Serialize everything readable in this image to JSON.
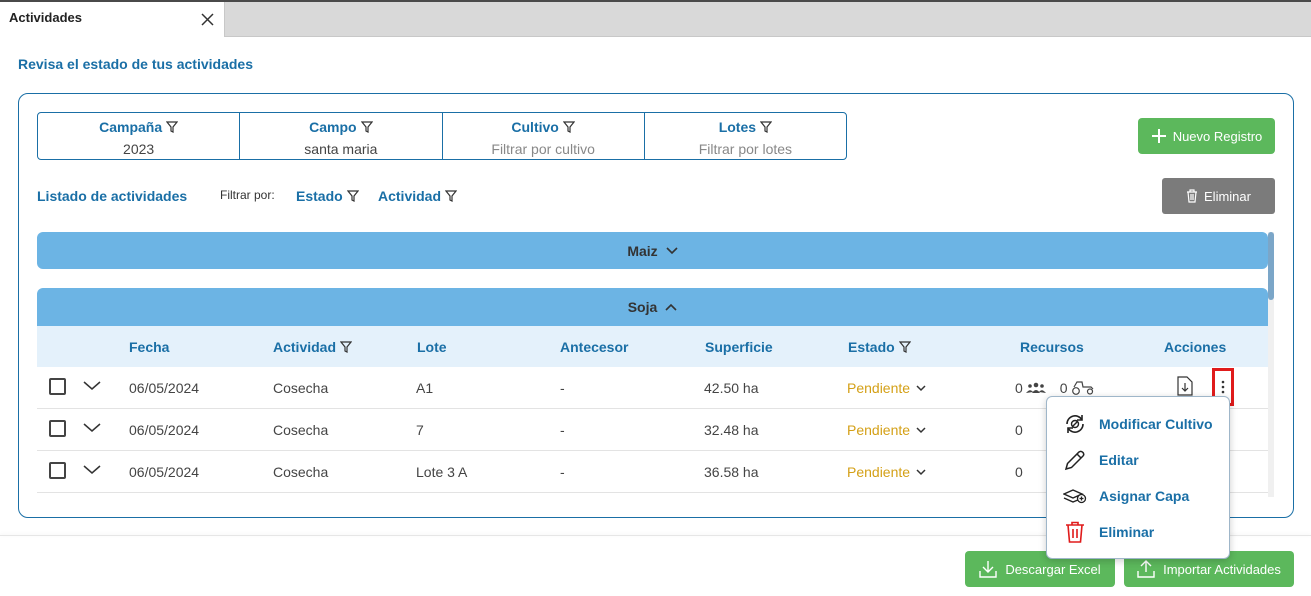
{
  "tab": {
    "title": "Actividades"
  },
  "page": {
    "subtitle": "Revisa el estado de tus actividades"
  },
  "filters": [
    {
      "label": "Campaña",
      "value": "2023",
      "is_placeholder": false
    },
    {
      "label": "Campo",
      "value": "santa maria",
      "is_placeholder": false
    },
    {
      "label": "Cultivo",
      "value": "Filtrar por cultivo",
      "is_placeholder": true
    },
    {
      "label": "Lotes",
      "value": "Filtrar por lotes",
      "is_placeholder": true
    }
  ],
  "buttons": {
    "new_record": "Nuevo Registro",
    "delete": "Eliminar",
    "download_excel": "Descargar Excel",
    "import": "Importar Actividades"
  },
  "list": {
    "title": "Listado de actividades",
    "filter_by": "Filtrar por:",
    "filter_estado": "Estado",
    "filter_actividad": "Actividad"
  },
  "groups": [
    {
      "name": "Maiz",
      "expanded": false
    },
    {
      "name": "Soja",
      "expanded": true
    }
  ],
  "table": {
    "headers": {
      "fecha": "Fecha",
      "actividad": "Actividad",
      "lote": "Lote",
      "antecesor": "Antecesor",
      "superficie": "Superficie",
      "estado": "Estado",
      "recursos": "Recursos",
      "acciones": "Acciones"
    },
    "rows": [
      {
        "fecha": "06/05/2024",
        "actividad": "Cosecha",
        "lote": "A1",
        "antecesor": "-",
        "superficie": "42.50 ha",
        "estado": "Pendiente",
        "personas": "0",
        "maquinas": "0"
      },
      {
        "fecha": "06/05/2024",
        "actividad": "Cosecha",
        "lote": "7",
        "antecesor": "-",
        "superficie": "32.48 ha",
        "estado": "Pendiente",
        "personas": "0",
        "maquinas": ""
      },
      {
        "fecha": "06/05/2024",
        "actividad": "Cosecha",
        "lote": "Lote 3 A",
        "antecesor": "-",
        "superficie": "36.58 ha",
        "estado": "Pendiente",
        "personas": "0",
        "maquinas": ""
      }
    ]
  },
  "context_menu": {
    "items": [
      {
        "label": "Modificar Cultivo",
        "icon": "modify-crop-icon"
      },
      {
        "label": "Editar",
        "icon": "pencil-icon"
      },
      {
        "label": "Asignar Capa",
        "icon": "layers-add-icon"
      },
      {
        "label": "Eliminar",
        "icon": "trash-icon"
      }
    ]
  },
  "colors": {
    "primary": "#1a6fa6",
    "green": "#5cb85c",
    "group_bar": "#6cb4e4",
    "pending": "#d4a017",
    "danger": "#e01b1b"
  }
}
